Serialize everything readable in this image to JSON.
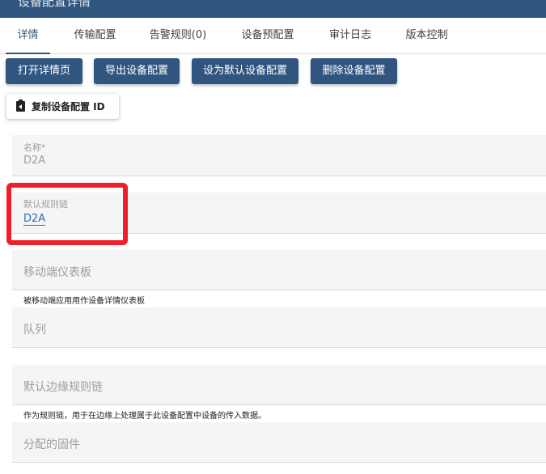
{
  "header": {
    "title": "设备配置详情"
  },
  "tabs": [
    {
      "label": "详情",
      "active": true
    },
    {
      "label": "传输配置"
    },
    {
      "label": "告警规则(0)"
    },
    {
      "label": "设备预配置"
    },
    {
      "label": "审计日志"
    },
    {
      "label": "版本控制"
    }
  ],
  "actions": {
    "open_details": "打开详情页",
    "export_profile": "导出设备配置",
    "set_default": "设为默认设备配置",
    "delete_profile": "删除设备配置",
    "copy_id": "复制设备配置 ID"
  },
  "form": {
    "name": {
      "label": "名称*",
      "value": "D2A"
    },
    "rule_chain": {
      "label": "默认规则链",
      "value": "D2A"
    },
    "mobile_dashboard": {
      "placeholder": "移动端仪表板",
      "hint": "被移动端应用用作设备详情仪表板"
    },
    "queue": {
      "placeholder": "队列"
    },
    "edge_rule_chain": {
      "placeholder": "默认边缘规则链",
      "hint": "作为规则链，用于在边缘上处理属于此设备配置中设备的传入数据。"
    },
    "firmware": {
      "placeholder": "分配的固件"
    }
  },
  "colors": {
    "primary": "#305680",
    "link": "#2a6bb5",
    "highlight_box": "#ee1e2a"
  }
}
